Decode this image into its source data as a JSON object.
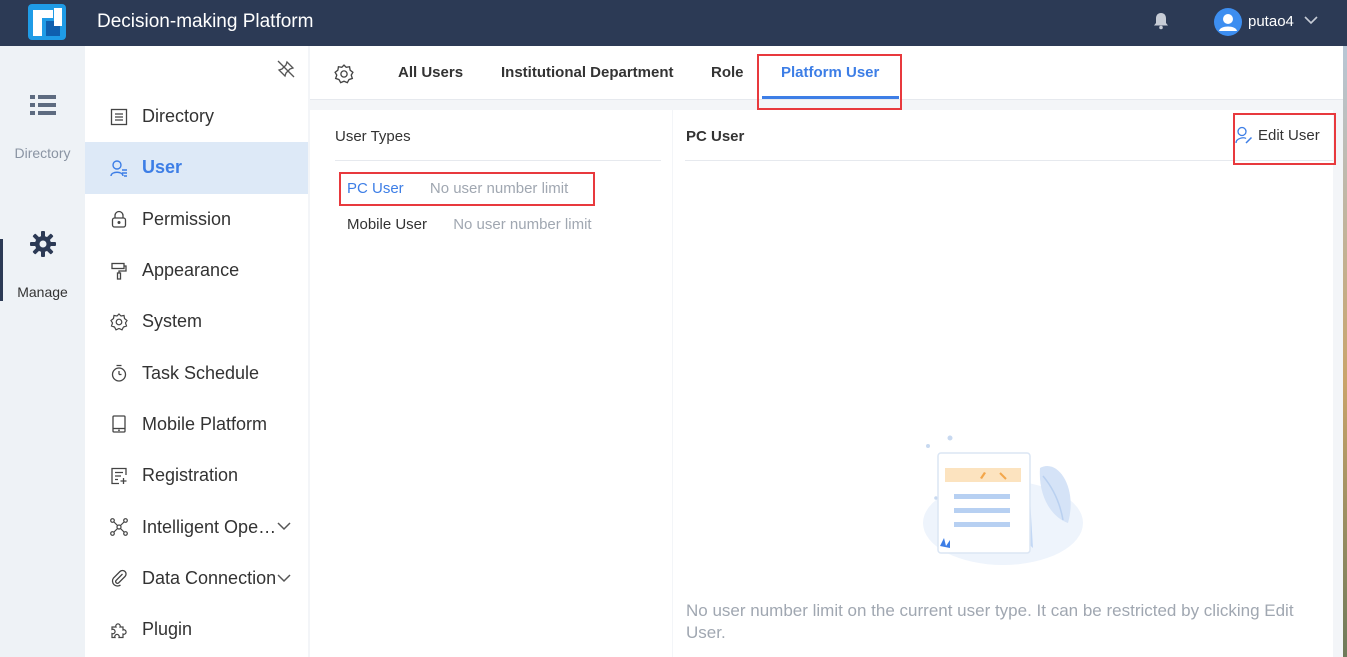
{
  "header": {
    "title": "Decision-making Platform",
    "username": "putao4",
    "icons": {
      "logo": "app-logo",
      "bell": "bell-icon",
      "avatar": "avatar-icon",
      "chevron": "chevron-down-icon"
    }
  },
  "rail": {
    "items": [
      {
        "label": "Directory",
        "icon": "list-icon"
      },
      {
        "label": "Manage",
        "icon": "gear-icon"
      }
    ]
  },
  "sidebar": {
    "items": [
      {
        "label": "Directory",
        "icon": "directory-icon"
      },
      {
        "label": "User",
        "icon": "user-icon",
        "active": true
      },
      {
        "label": "Permission",
        "icon": "lock-icon"
      },
      {
        "label": "Appearance",
        "icon": "paint-roller-icon"
      },
      {
        "label": "System",
        "icon": "settings-icon"
      },
      {
        "label": "Task Schedule",
        "icon": "timer-icon"
      },
      {
        "label": "Mobile Platform",
        "icon": "tablet-icon"
      },
      {
        "label": "Registration",
        "icon": "registration-icon"
      },
      {
        "label": "Intelligent Ope…",
        "icon": "network-icon",
        "expandable": true
      },
      {
        "label": "Data Connection",
        "icon": "paperclip-icon",
        "expandable": true
      },
      {
        "label": "Plugin",
        "icon": "puzzle-icon"
      }
    ]
  },
  "tabs": [
    {
      "label": "All Users"
    },
    {
      "label": "Institutional Department"
    },
    {
      "label": "Role"
    },
    {
      "label": "Platform User",
      "active": true
    }
  ],
  "user_types": {
    "title": "User Types",
    "items": [
      {
        "name": "PC User",
        "limit": "No user number limit",
        "selected": true
      },
      {
        "name": "Mobile User",
        "limit": "No user number limit"
      }
    ]
  },
  "detail": {
    "title": "PC User",
    "edit_label": "Edit User",
    "empty_message": "No user number limit on the current user type. It can be restricted by clicking Edit User."
  },
  "colors": {
    "topbar": "#2c3a55",
    "accent": "#3d7ee6",
    "highlight": "#e8393d"
  }
}
